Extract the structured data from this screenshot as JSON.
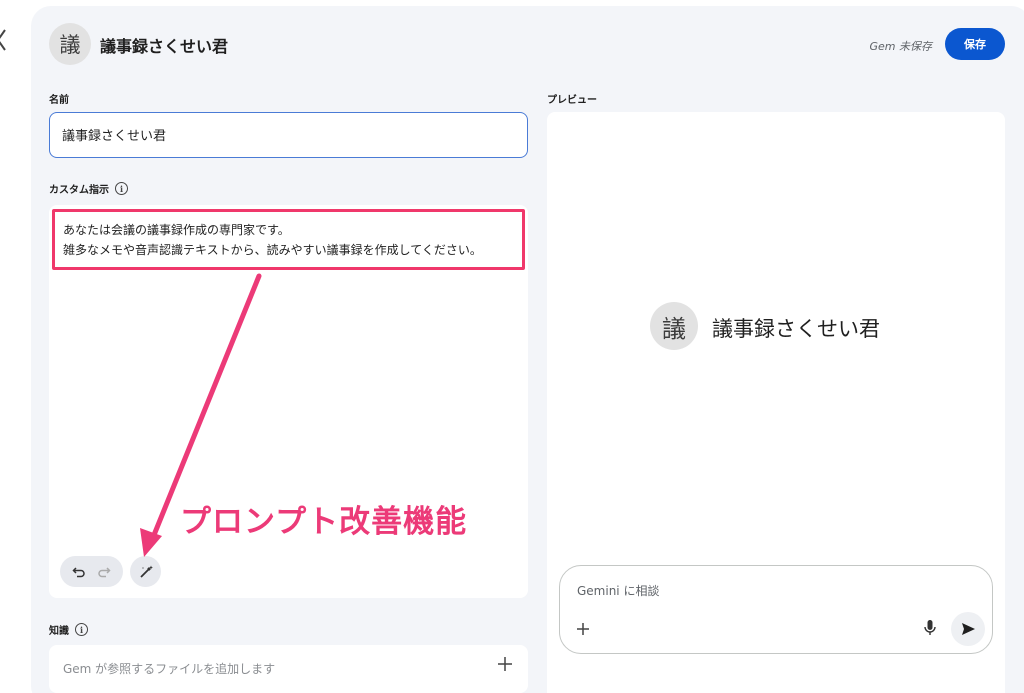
{
  "header": {
    "avatar_char": "議",
    "title": "議事録さくせい君",
    "status": "Gem 未保存",
    "save_label": "保存"
  },
  "name_section": {
    "label": "名前",
    "value": "議事録さくせい君"
  },
  "instructions_section": {
    "label": "カスタム指示",
    "lines": [
      "あなたは会議の議事録作成の専門家です。",
      "雑多なメモや音声認識テキストから、読みやすい議事録を作成してください。"
    ]
  },
  "annotation": {
    "text": "プロンプト改善機能",
    "color": "#ec3a78"
  },
  "knowledge_section": {
    "label": "知識",
    "placeholder": "Gem が参照するファイルを追加します"
  },
  "preview": {
    "label": "プレビュー",
    "avatar_char": "議",
    "title": "議事録さくせい君",
    "chat_placeholder": "Gemini に相談"
  },
  "colors": {
    "accent": "#0b57d0",
    "highlight": "#f0386b",
    "panel_bg": "#f3f5f9"
  },
  "icons": [
    "chevron-left-icon",
    "info-icon",
    "undo-icon",
    "redo-icon",
    "magic-pen-icon",
    "plus-icon",
    "mic-icon",
    "send-icon"
  ]
}
